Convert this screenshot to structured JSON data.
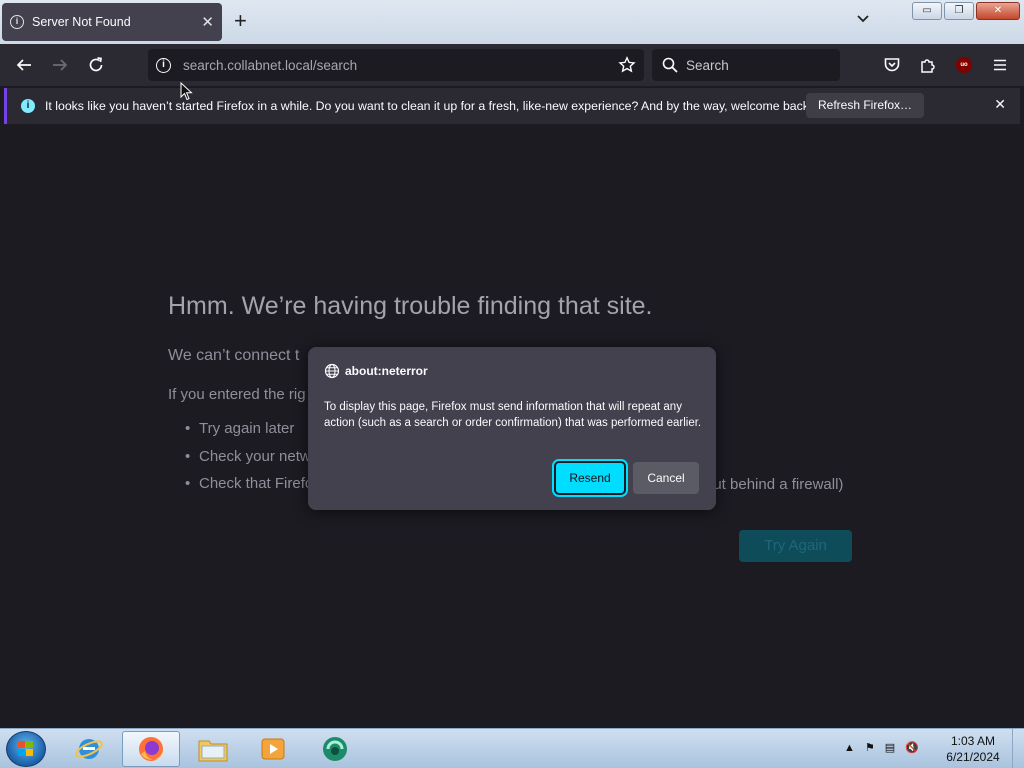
{
  "browser": {
    "tab": {
      "title": "Server Not Found"
    },
    "url": {
      "host": "search.collabnet.local",
      "path": "/search"
    },
    "search": {
      "placeholder": "Search"
    },
    "extension_badge": "uo"
  },
  "notification": {
    "message": "It looks like you haven’t started Firefox in a while. Do you want to clean it up for a fresh, like-new experience? And by the way, welcome back!",
    "button": "Refresh Firefox…"
  },
  "error_page": {
    "title": "Hmm. We’re having trouble finding that site.",
    "subtitle": "We can’t connect t",
    "intro": "If you entered the rig",
    "items": [
      "Try again later",
      "Check your netw",
      "Check that Firefc"
    ],
    "tail": "out behind a firewall)",
    "try_again": "Try Again"
  },
  "dialog": {
    "title": "about:neterror",
    "body": "To display this page, Firefox must send information that will repeat any action (such as a search or order confirmation) that was performed earlier.",
    "resend": "Resend",
    "cancel": "Cancel"
  },
  "taskbar": {
    "time": "1:03 AM",
    "date": "6/21/2024"
  }
}
